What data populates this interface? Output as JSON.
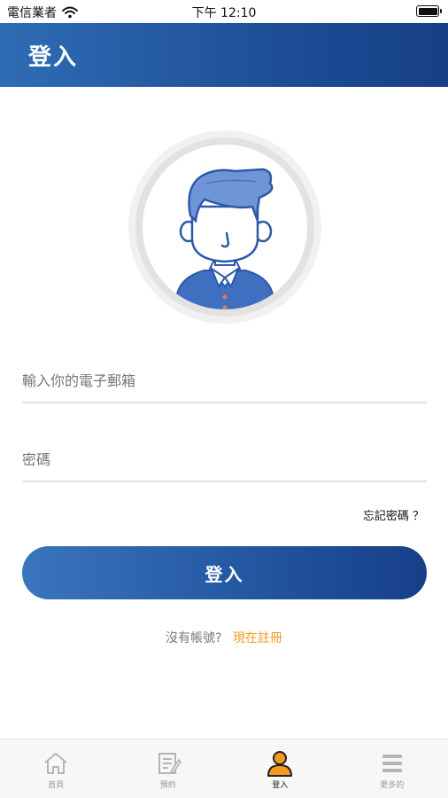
{
  "status_bar": {
    "carrier": "電信業者",
    "time": "下午 12:10"
  },
  "header": {
    "title": "登入"
  },
  "avatar": {
    "icon": "user-avatar-icon"
  },
  "form": {
    "email_placeholder": "輸入你的電子郵箱",
    "email_value": "",
    "password_placeholder": "密碼",
    "password_value": "",
    "forgot_password": "忘記密碼 ？",
    "login_button": "登入"
  },
  "signup": {
    "prompt": "沒有帳號?",
    "link": "現在註冊"
  },
  "tab_bar": {
    "items": [
      {
        "label": "首頁",
        "icon": "home-icon",
        "active": false
      },
      {
        "label": "預約",
        "icon": "booking-icon",
        "active": false
      },
      {
        "label": "登入",
        "icon": "user-icon",
        "active": true
      },
      {
        "label": "更多的",
        "icon": "menu-icon",
        "active": false
      }
    ]
  },
  "colors": {
    "primary": "#1e4f97",
    "accent": "#f39a1f",
    "avatar_blue": "#3f6fc0"
  }
}
